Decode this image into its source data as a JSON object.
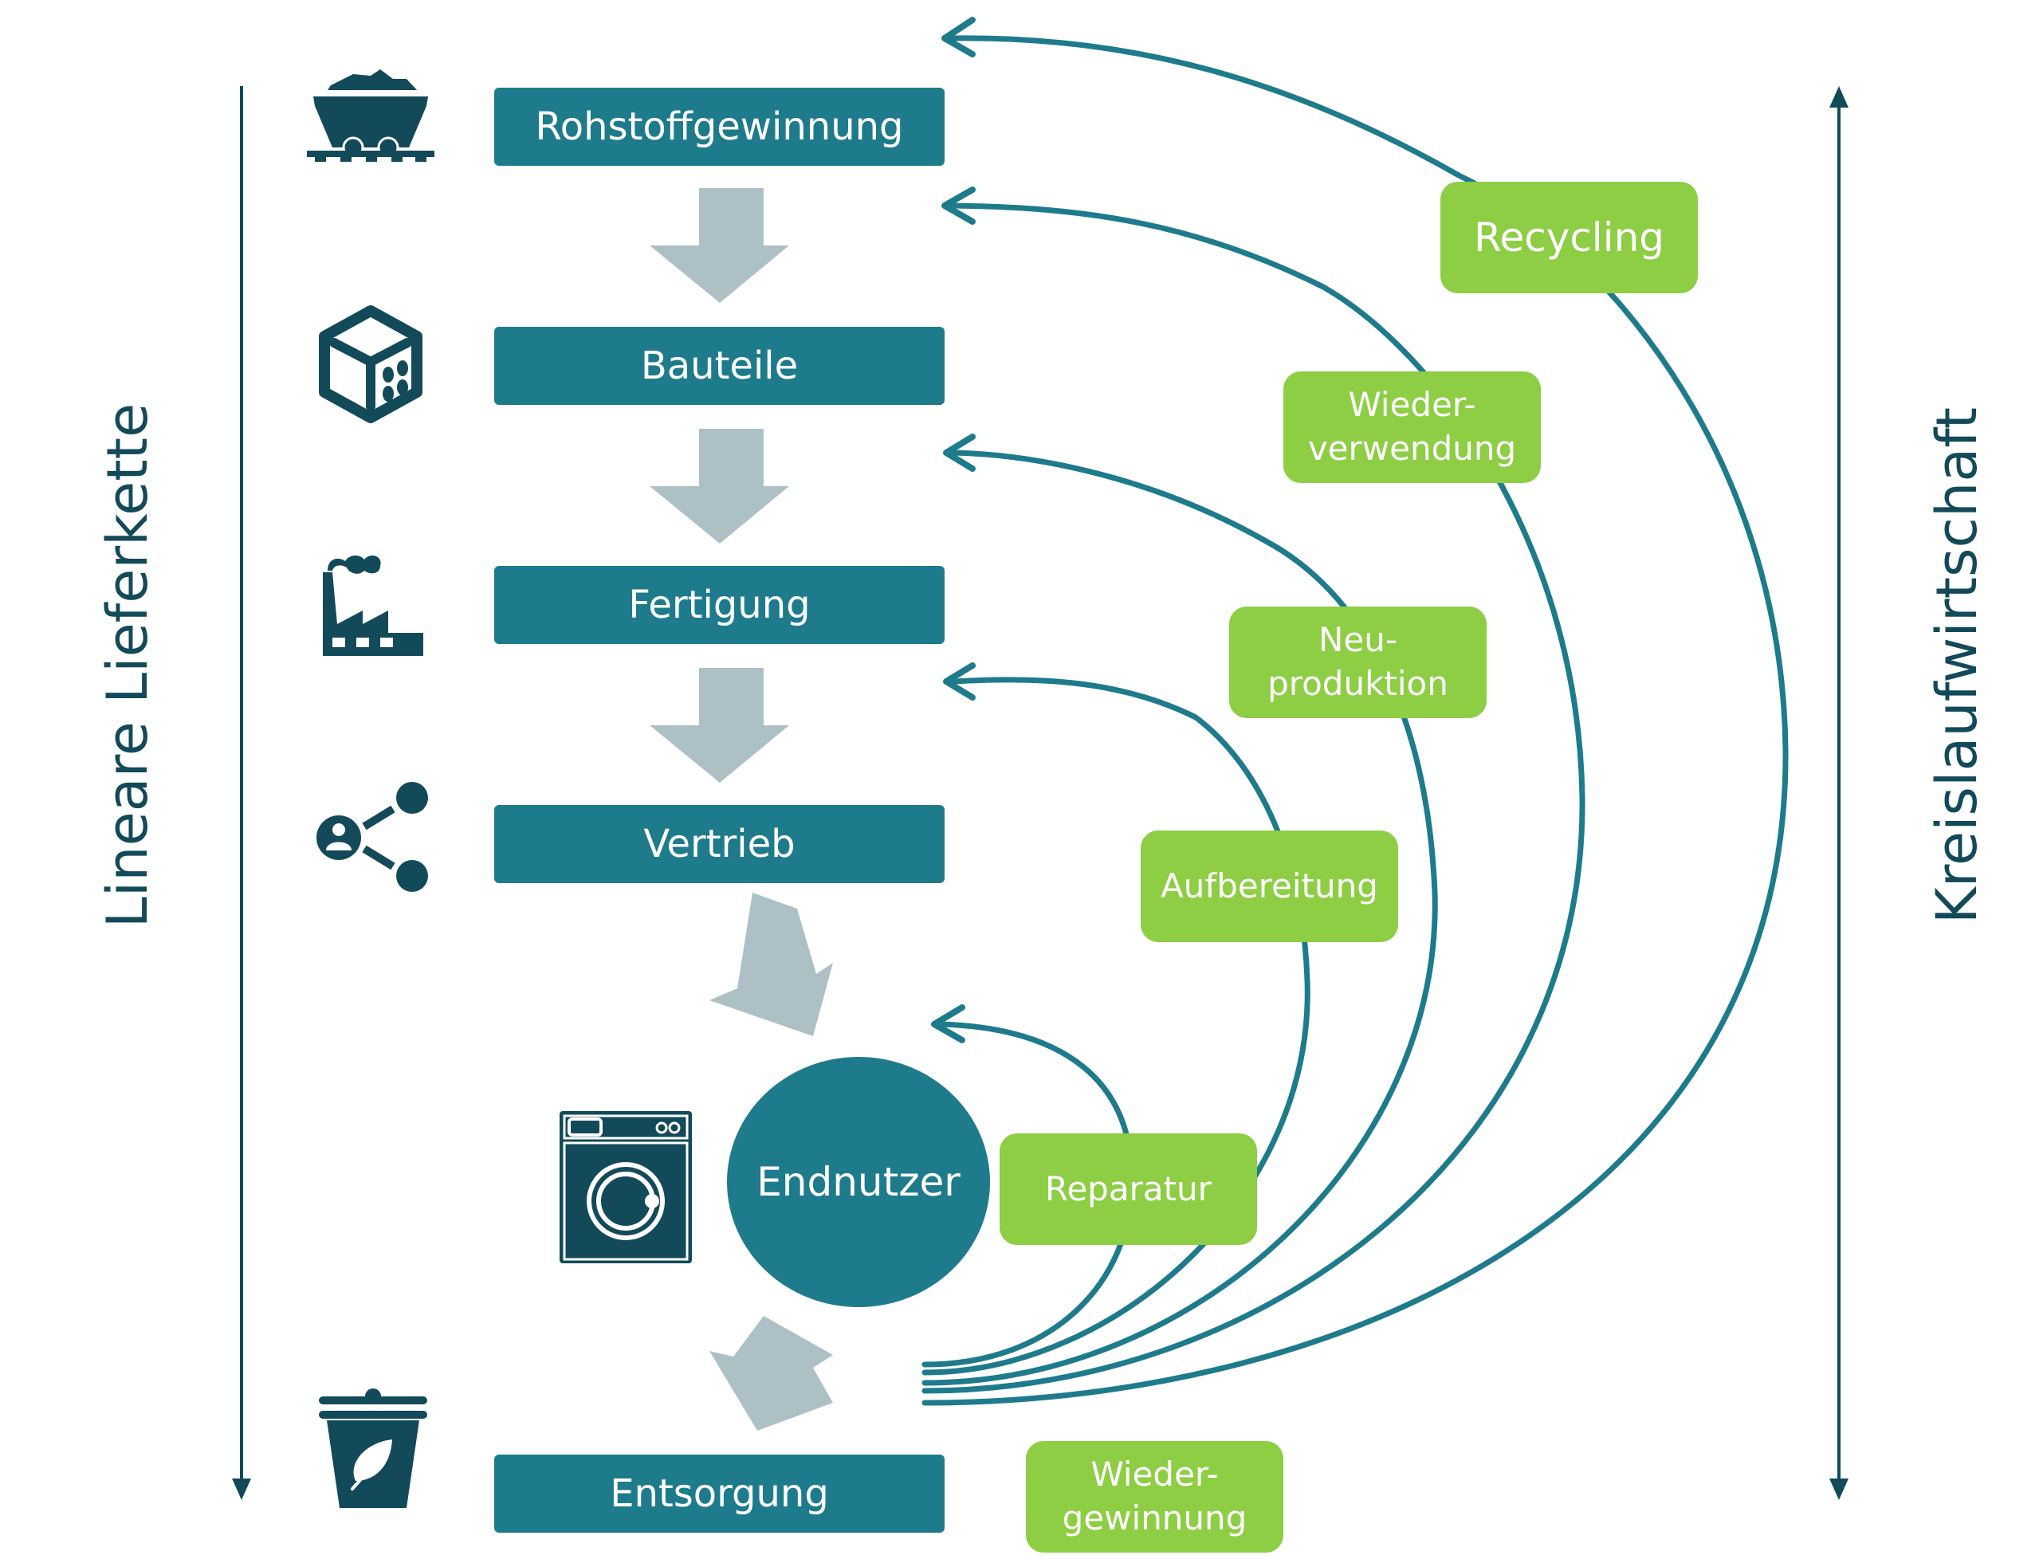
{
  "colors": {
    "teal_box": "#1e7b8c",
    "dark_teal": "#134a5a",
    "green": "#8dce44",
    "gray_arrow": "#adc0c6",
    "curve": "#1e7b8c"
  },
  "left_axis": {
    "label": "Lineare Lieferkette",
    "direction": "down"
  },
  "right_axis": {
    "label": "Kreislaufwirtschaft",
    "direction": "both"
  },
  "linear_steps": [
    {
      "label": "Rohstoffgewinnung",
      "icon": "mine-cart-icon"
    },
    {
      "label": "Bauteile",
      "icon": "dice-component-icon"
    },
    {
      "label": "Fertigung",
      "icon": "factory-icon"
    },
    {
      "label": "Vertrieb",
      "icon": "share-distribution-icon"
    },
    {
      "label": "Endnutzer",
      "icon": "washing-machine-icon"
    },
    {
      "label": "Entsorgung",
      "icon": "eco-trash-bin-icon"
    }
  ],
  "circular_loops": [
    {
      "label": "Recycling",
      "returns_to": "Rohstoffgewinnung"
    },
    {
      "label": "Wieder-\nverwendung",
      "returns_to": "Bauteile"
    },
    {
      "label": "Neu-\nproduktion",
      "returns_to": "Fertigung"
    },
    {
      "label": "Aufbereitung",
      "returns_to": "Vertrieb"
    },
    {
      "label": "Reparatur",
      "returns_to": "Endnutzer"
    },
    {
      "label": "Wieder-\ngewinnung",
      "returns_to": ""
    }
  ]
}
